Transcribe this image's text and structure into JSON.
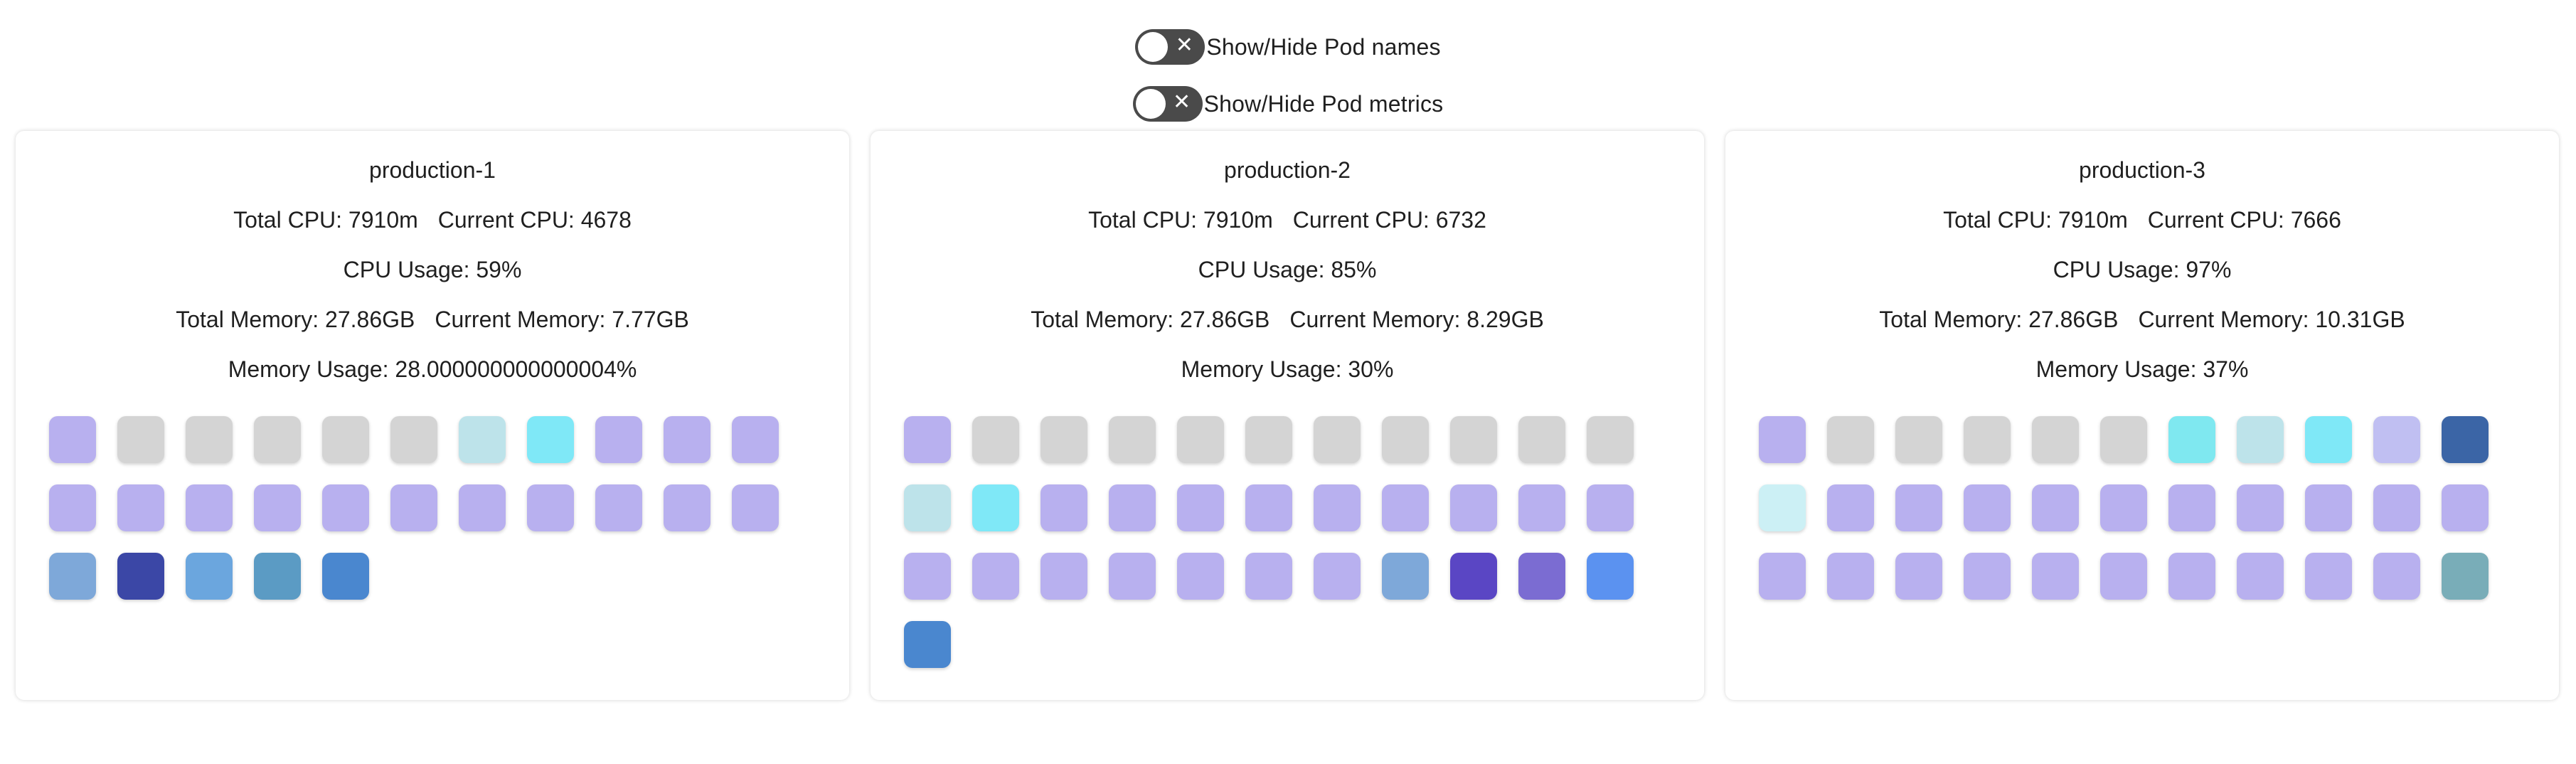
{
  "toggles": [
    {
      "label": "Show/Hide Pod names",
      "on": false
    },
    {
      "label": "Show/Hide Pod metrics",
      "on": false
    }
  ],
  "clusters": [
    {
      "name": "production-1",
      "total_cpu": "Total CPU: 7910m",
      "current_cpu": "Current CPU: 4678",
      "cpu_usage": "CPU Usage: 59%",
      "total_memory": "Total Memory: 27.86GB",
      "current_memory": "Current Memory: 7.77GB",
      "memory_usage": "Memory Usage: 28.000000000000004%",
      "pods": [
        "#b8b0ef",
        "#d4d4d4",
        "#d4d4d4",
        "#d4d4d4",
        "#d4d4d4",
        "#d4d4d4",
        "#bde3ea",
        "#7fe8f7",
        "#b8b0ef",
        "#b8b0ef",
        "#b8b0ef",
        "#b8b0ef",
        "#b8b0ef",
        "#b8b0ef",
        "#b8b0ef",
        "#b8b0ef",
        "#b8b0ef",
        "#b8b0ef",
        "#b8b0ef",
        "#b8b0ef",
        "#b8b0ef",
        "#b8b0ef",
        "#7ea8d9",
        "#3b47a6",
        "#6ba6de",
        "#5b9bc4",
        "#4a87cf"
      ]
    },
    {
      "name": "production-2",
      "total_cpu": "Total CPU: 7910m",
      "current_cpu": "Current CPU: 6732",
      "cpu_usage": "CPU Usage: 85%",
      "total_memory": "Total Memory: 27.86GB",
      "current_memory": "Current Memory: 8.29GB",
      "memory_usage": "Memory Usage: 30%",
      "pods": [
        "#b8b0ef",
        "#d4d4d4",
        "#d4d4d4",
        "#d4d4d4",
        "#d4d4d4",
        "#d4d4d4",
        "#d4d4d4",
        "#d4d4d4",
        "#d4d4d4",
        "#d4d4d4",
        "#d4d4d4",
        "#bde3ea",
        "#7fe8f7",
        "#b8b0ef",
        "#b8b0ef",
        "#b8b0ef",
        "#b8b0ef",
        "#b8b0ef",
        "#b8b0ef",
        "#b8b0ef",
        "#b8b0ef",
        "#b8b0ef",
        "#b8b0ef",
        "#b8b0ef",
        "#b8b0ef",
        "#b8b0ef",
        "#b8b0ef",
        "#b8b0ef",
        "#b8b0ef",
        "#7ea8d9",
        "#5a46c4",
        "#7b6cd2",
        "#5b92f0",
        "#4a87cf"
      ]
    },
    {
      "name": "production-3",
      "total_cpu": "Total CPU: 7910m",
      "current_cpu": "Current CPU: 7666",
      "cpu_usage": "CPU Usage: 97%",
      "total_memory": "Total Memory: 27.86GB",
      "current_memory": "Current Memory: 10.31GB",
      "memory_usage": "Memory Usage: 37%",
      "pods": [
        "#b8b0ef",
        "#d4d4d4",
        "#d4d4d4",
        "#d4d4d4",
        "#d4d4d4",
        "#d4d4d4",
        "#7fe8f0",
        "#bde3ea",
        "#7fe8f7",
        "#c0bff2",
        "#3b65a6",
        "#ccf0f5",
        "#b8b0ef",
        "#b8b0ef",
        "#b8b0ef",
        "#b8b0ef",
        "#b8b0ef",
        "#b8b0ef",
        "#b8b0ef",
        "#b8b0ef",
        "#b8b0ef",
        "#b8b0ef",
        "#b8b0ef",
        "#b8b0ef",
        "#b8b0ef",
        "#b8b0ef",
        "#b8b0ef",
        "#b8b0ef",
        "#b8b0ef",
        "#b8b0ef",
        "#b8b0ef",
        "#b8b0ef",
        "#79adb8"
      ]
    }
  ]
}
